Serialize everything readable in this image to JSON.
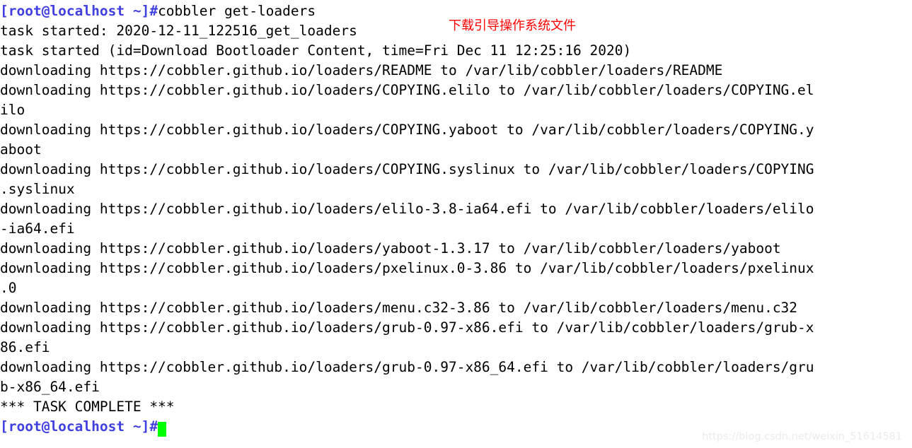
{
  "terminal": {
    "background_color": "#ffffff",
    "foreground_color": "#000000",
    "prompt_color": "#4040e0",
    "cursor_color": "#00ff00",
    "annotation_color": "#ff0000",
    "prompt_text": "[root@localhost ~]#",
    "command": "cobbler get-loaders",
    "lines": [
      "task started: 2020-12-11_122516_get_loaders",
      "task started (id=Download Bootloader Content, time=Fri Dec 11 12:25:16 2020)",
      "downloading https://cobbler.github.io/loaders/README to /var/lib/cobbler/loaders/README",
      "downloading https://cobbler.github.io/loaders/COPYING.elilo to /var/lib/cobbler/loaders/COPYING.el",
      "ilo",
      "downloading https://cobbler.github.io/loaders/COPYING.yaboot to /var/lib/cobbler/loaders/COPYING.y",
      "aboot",
      "downloading https://cobbler.github.io/loaders/COPYING.syslinux to /var/lib/cobbler/loaders/COPYING",
      ".syslinux",
      "downloading https://cobbler.github.io/loaders/elilo-3.8-ia64.efi to /var/lib/cobbler/loaders/elilo",
      "-ia64.efi",
      "downloading https://cobbler.github.io/loaders/yaboot-1.3.17 to /var/lib/cobbler/loaders/yaboot",
      "downloading https://cobbler.github.io/loaders/pxelinux.0-3.86 to /var/lib/cobbler/loaders/pxelinux",
      ".0",
      "downloading https://cobbler.github.io/loaders/menu.c32-3.86 to /var/lib/cobbler/loaders/menu.c32",
      "downloading https://cobbler.github.io/loaders/grub-0.97-x86.efi to /var/lib/cobbler/loaders/grub-x",
      "86.efi",
      "downloading https://cobbler.github.io/loaders/grub-0.97-x86_64.efi to /var/lib/cobbler/loaders/gru",
      "b-x86_64.efi",
      "*** TASK COMPLETE ***"
    ],
    "final_prompt_text": "[root@localhost ~]#"
  },
  "annotation": {
    "text": "下载引导操作系统文件"
  },
  "watermark": {
    "text": "https://blog.csdn.net/weixin_51614581"
  }
}
